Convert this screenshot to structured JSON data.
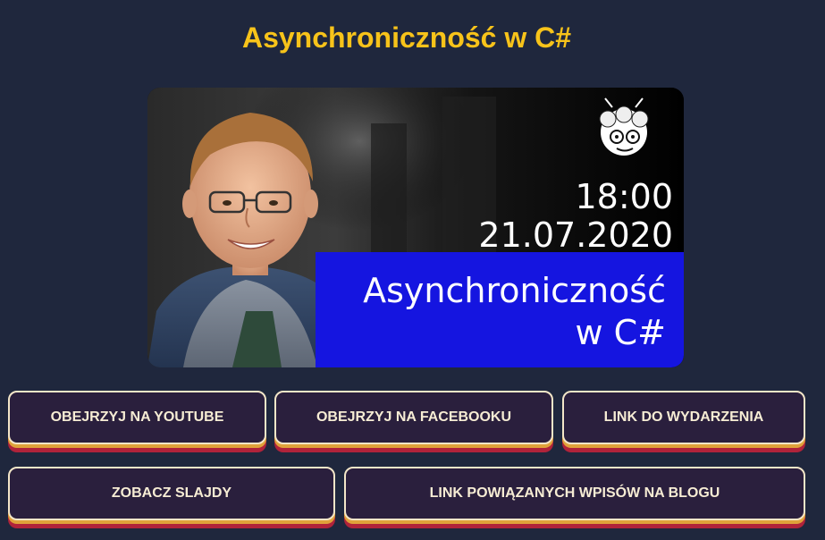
{
  "page": {
    "title": "Asynchroniczność w C#"
  },
  "banner": {
    "time": "18:00",
    "date": "21.07.2020",
    "title_line1": "Asynchroniczność",
    "title_line2": "w C#"
  },
  "buttons": {
    "youtube": "OBEJRZYJ NA YOUTUBE",
    "facebook": "OBEJRZYJ NA FACEBOOKU",
    "event": "LINK DO WYDARZENIA",
    "slides": "ZOBACZ SLAJDY",
    "blog": "LINK POWIĄZANYCH WPISÓW NA BLOGU"
  },
  "colors": {
    "background": "#1f273d",
    "title": "#f7c31a",
    "button_bg": "#2a1f3d",
    "button_border": "#f3e6c8",
    "banner_blue": "#1515e0"
  }
}
